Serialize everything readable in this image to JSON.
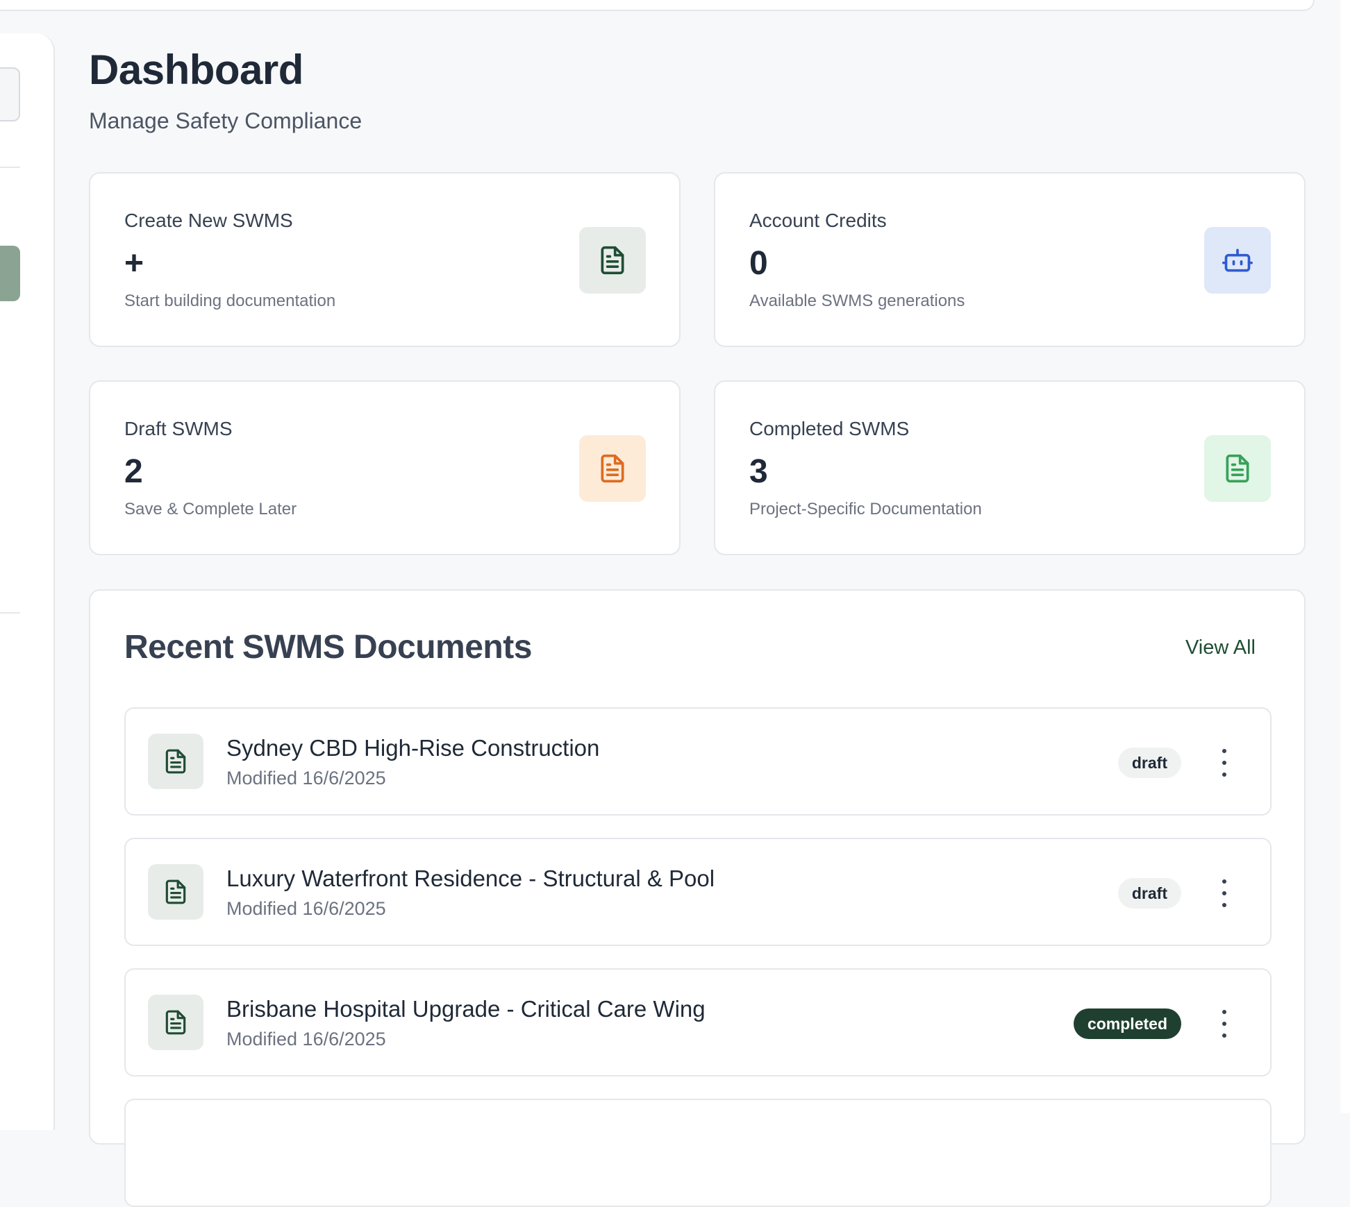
{
  "header": {
    "title": "Dashboard",
    "subtitle": "Manage Safety Compliance"
  },
  "stats": [
    {
      "label": "Create New SWMS",
      "value": "+",
      "description": "Start building documentation",
      "icon": "file-text-icon",
      "icon_color": "#1f4d34",
      "icon_bg": "#e8ece9"
    },
    {
      "label": "Account Credits",
      "value": "0",
      "description": "Available SWMS generations",
      "icon": "robot-icon",
      "icon_color": "#2f5bd0",
      "icon_bg": "#dfe8f8"
    },
    {
      "label": "Draft SWMS",
      "value": "2",
      "description": "Save & Complete Later",
      "icon": "file-text-icon",
      "icon_color": "#dd6b20",
      "icon_bg": "#fdebd8"
    },
    {
      "label": "Completed SWMS",
      "value": "3",
      "description": "Project-Specific Documentation",
      "icon": "file-text-icon",
      "icon_color": "#38a15a",
      "icon_bg": "#e1f6e6"
    }
  ],
  "recent": {
    "title": "Recent SWMS Documents",
    "view_all_label": "View All",
    "documents": [
      {
        "name": "Sydney CBD High-Rise Construction",
        "modified": "Modified 16/6/2025",
        "status": "draft"
      },
      {
        "name": "Luxury Waterfront Residence - Structural & Pool",
        "modified": "Modified 16/6/2025",
        "status": "draft"
      },
      {
        "name": "Brisbane Hospital Upgrade - Critical Care Wing",
        "modified": "Modified 16/6/2025",
        "status": "completed"
      }
    ]
  },
  "colors": {
    "brand_dark_green": "#1f4030",
    "accent_green": "#1f4d34",
    "sidebar_active": "#8aa393"
  }
}
